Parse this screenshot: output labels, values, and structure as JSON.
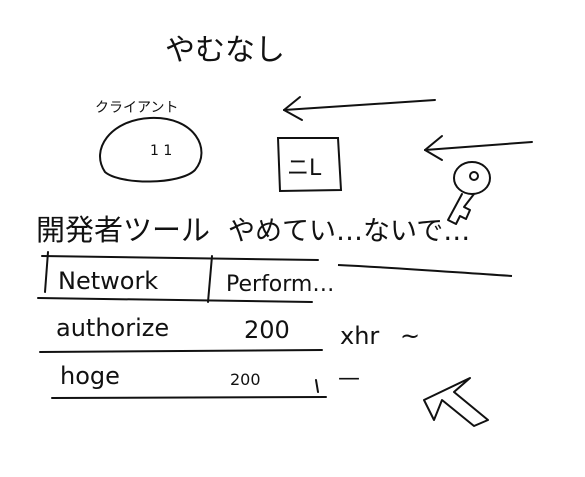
{
  "title": "やむなし",
  "client": {
    "label": "クライアント",
    "face": "1 1"
  },
  "window_icon_text": "ニL",
  "heading": {
    "part1": "開発者ツール",
    "part2": "やめてい…ないで…"
  },
  "table": {
    "headers": [
      "Network",
      "Perform…"
    ],
    "rows": [
      [
        "authorize",
        "200",
        "xhr",
        "~"
      ],
      [
        "hoge",
        "200",
        "—",
        ""
      ]
    ]
  },
  "icons": [
    "left-arrow-icon",
    "left-arrow-icon",
    "key-icon",
    "cursor-arrow-icon"
  ]
}
